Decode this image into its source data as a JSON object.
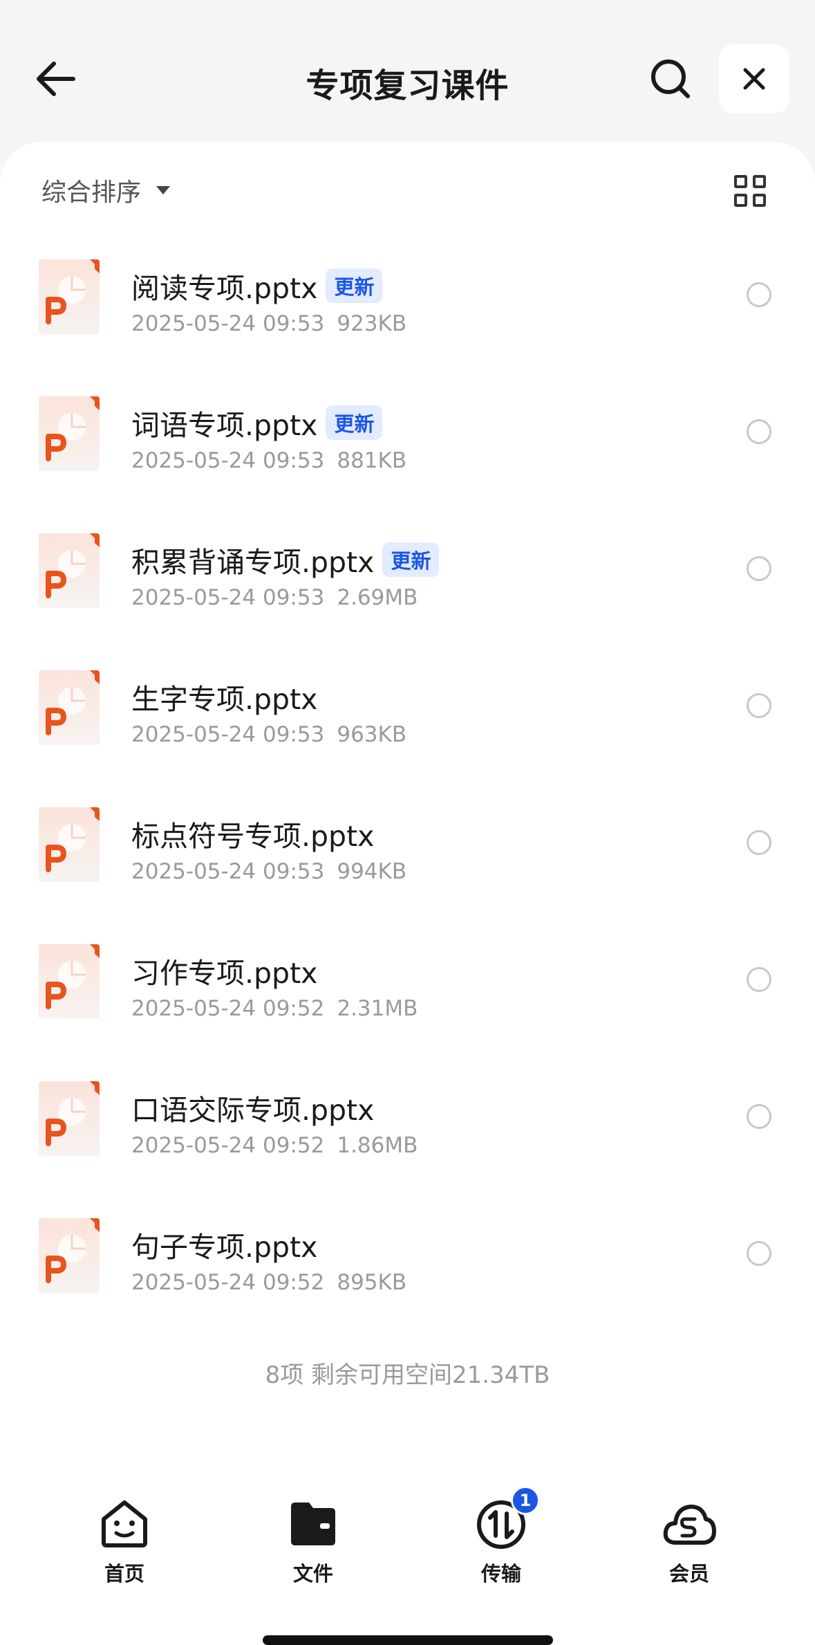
{
  "header": {
    "title": "专项复习课件",
    "back_icon": "arrow-left-icon",
    "search_icon": "search-icon",
    "close_icon": "close-icon"
  },
  "toolbar": {
    "sort_label": "综合排序",
    "sort_icon": "caret-down-icon",
    "view_toggle_icon": "grid-view-icon"
  },
  "files": [
    {
      "name": "阅读专项.pptx",
      "badge": "更新",
      "date": "2025-05-24 09:53",
      "size": "923KB"
    },
    {
      "name": "词语专项.pptx",
      "badge": "更新",
      "date": "2025-05-24 09:53",
      "size": "881KB"
    },
    {
      "name": "积累背诵专项.pptx",
      "badge": "更新",
      "date": "2025-05-24 09:53",
      "size": "2.69MB"
    },
    {
      "name": "生字专项.pptx",
      "badge": "",
      "date": "2025-05-24 09:53",
      "size": "963KB"
    },
    {
      "name": "标点符号专项.pptx",
      "badge": "",
      "date": "2025-05-24 09:53",
      "size": "994KB"
    },
    {
      "name": "习作专项.pptx",
      "badge": "",
      "date": "2025-05-24 09:52",
      "size": "2.31MB"
    },
    {
      "name": "口语交际专项.pptx",
      "badge": "",
      "date": "2025-05-24 09:52",
      "size": "1.86MB"
    },
    {
      "name": "句子专项.pptx",
      "badge": "",
      "date": "2025-05-24 09:52",
      "size": "895KB"
    }
  ],
  "file_icon": "powerpoint-file-icon",
  "summary": "8项 剩余可用空间21.34TB",
  "tabbar": {
    "tabs": [
      {
        "label": "首页",
        "icon": "home-smile-icon"
      },
      {
        "label": "文件",
        "icon": "folder-icon"
      },
      {
        "label": "传输",
        "icon": "transfer-icon",
        "badge": "1"
      },
      {
        "label": "会员",
        "icon": "cloud-membership-icon"
      }
    ]
  },
  "colors": {
    "accent": "#1a56e6",
    "badge_bg": "#e3ebff",
    "ppt_orange": "#e8541e",
    "page_bg": "#f5f5f7"
  }
}
